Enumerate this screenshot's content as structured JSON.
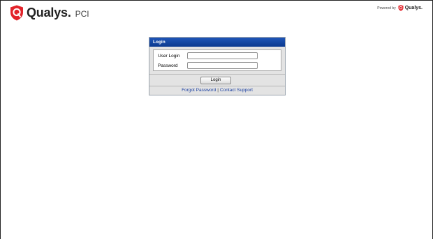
{
  "header": {
    "brand": "Qualys.",
    "product": "PCI",
    "powered_label": "Powered by",
    "powered_brand": "Qualys.",
    "brand_color": "#e2232a"
  },
  "login": {
    "title": "Login",
    "user_login_label": "User Login",
    "user_login_value": "",
    "password_label": "Password",
    "password_value": "",
    "submit_label": "Login"
  },
  "links": {
    "forgot_password": "Forgot Password",
    "separator": "|",
    "contact_support": "Contact Support"
  }
}
